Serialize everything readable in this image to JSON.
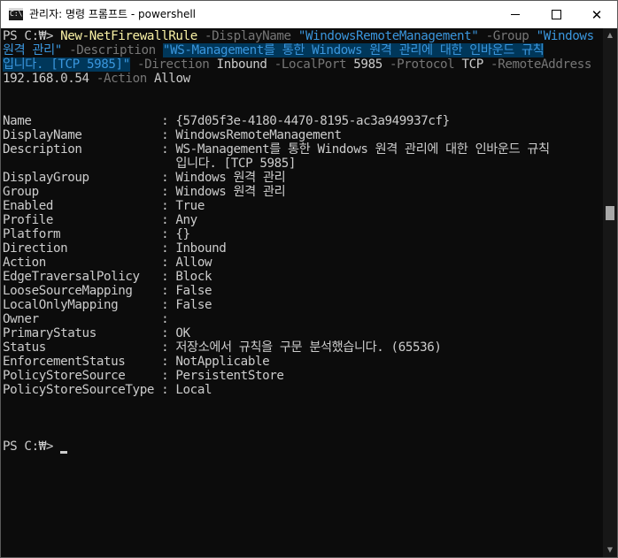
{
  "window": {
    "title": "관리자: 명령 프롬프트 - powershell",
    "app_icon_text": "C:\\",
    "icon_names": [
      "cmd-app-icon",
      "minimize-icon",
      "maximize-icon",
      "close-icon"
    ],
    "close_glyph": "✕"
  },
  "command": {
    "prompt": "PS C:₩> ",
    "cmdlet": "New-NetFirewallRule",
    "line1": {
      "p1": "-DisplayName",
      "v1": "\"WindowsRemoteManagement\"",
      "p2": "-Group",
      "v2a": "\"Windows"
    },
    "line2": {
      "v2b": "원격 관리\"",
      "p3": "-Description",
      "v3a": "\"WS-Management를 통한 Windows 원격 관리에 대한 인바운드 규칙"
    },
    "line3": {
      "v3b": "입니다. [TCP 5985]\"",
      "p4": "-Direction",
      "v4": "Inbound",
      "p5": "-LocalPort",
      "v5": "5985",
      "p6": "-Protocol",
      "v6": "TCP",
      "p7": "-RemoteAddress"
    },
    "line4": {
      "v7": "192.168.0.54",
      "p8": "-Action",
      "v8": "Allow"
    }
  },
  "output": [
    "Name                  : {57d05f3e-4180-4470-8195-ac3a949937cf}",
    "DisplayName           : WindowsRemoteManagement",
    "Description           : WS-Management를 통한 Windows 원격 관리에 대한 인바운드 규칙",
    "                        입니다. [TCP 5985]",
    "DisplayGroup          : Windows 원격 관리",
    "Group                 : Windows 원격 관리",
    "Enabled               : True",
    "Profile               : Any",
    "Platform              : {}",
    "Direction             : Inbound",
    "Action                : Allow",
    "EdgeTraversalPolicy   : Block",
    "LooseSourceMapping    : False",
    "LocalOnlyMapping      : False",
    "Owner                 :",
    "PrimaryStatus         : OK",
    "Status                : 저장소에서 규칙을 구문 분석했습니다. (65536)",
    "EnforcementStatus     : NotApplicable",
    "PolicyStoreSource     : PersistentStore",
    "PolicyStoreSourceType : Local"
  ],
  "final_prompt": "PS C:₩> ",
  "colors": {
    "console_bg": "#0c0c0c",
    "text": "#cccccc",
    "cmdlet": "#f9f1a5",
    "parameter": "#767676",
    "string": "#3a96dd",
    "string_highlight": "#00375a"
  }
}
